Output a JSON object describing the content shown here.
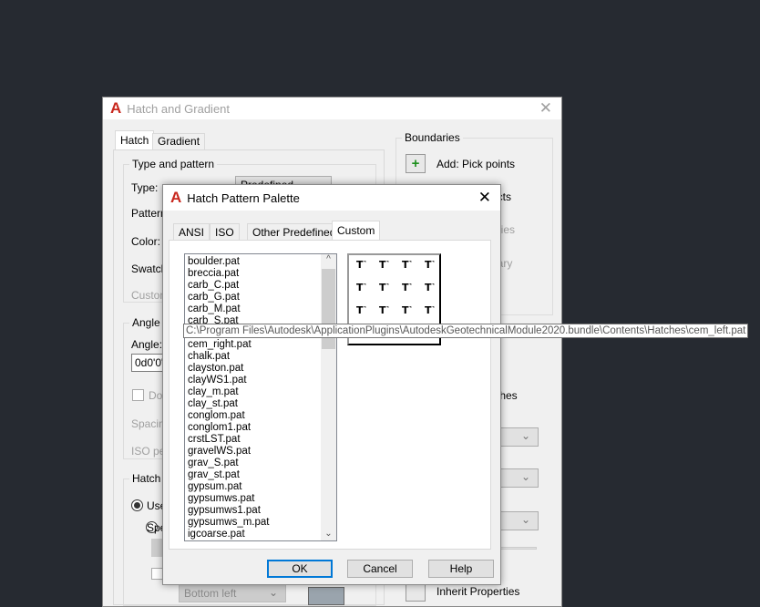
{
  "main": {
    "title": "Hatch and Gradient",
    "tabs": [
      "Hatch",
      "Gradient"
    ],
    "type_group": "Type and pattern",
    "type_label": "Type:",
    "type_value": "Predefined",
    "pattern_label": "Pattern",
    "color_label": "Color:",
    "swatch_label": "Swatch",
    "custom_label": "Custom",
    "angle_group": "Angle a",
    "angle_label": "Angle:",
    "angle_value": "0d0'0\"",
    "double_label": "Dou",
    "spacing_label": "Spacin",
    "iso_label": "ISO pe",
    "origin_group": "Hatch o",
    "use_current": "Use",
    "specified": "Spe",
    "origin_pos": "Bottom left",
    "boundaries_group": "Boundaries",
    "pick_points": "Add: Pick points",
    "select_objects": "ects",
    "remove": "aries",
    "recreate": "dary",
    "view": "s",
    "separate": "tches",
    "draw_order": "y",
    "inherit": "Inherit Properties"
  },
  "palette": {
    "title": "Hatch Pattern Palette",
    "tabs": [
      "ANSI",
      "ISO",
      "Other Predefined",
      "Custom"
    ],
    "active_tab": "Custom",
    "items": [
      "boulder.pat",
      "breccia.pat",
      "carb_C.pat",
      "carb_G.pat",
      "carb_M.pat",
      "carb_S.pat",
      "cem_left.pat",
      "cem_right.pat",
      "chalk.pat",
      "clayston.pat",
      "clayWS1.pat",
      "clay_m.pat",
      "clay_st.pat",
      "conglom.pat",
      "conglom1.pat",
      "crstLST.pat",
      "gravelWS.pat",
      "grav_S.pat",
      "grav_st.pat",
      "gypsum.pat",
      "gypsumws.pat",
      "gypsumws1.pat",
      "gypsumws_m.pat",
      "igcoarse.pat"
    ],
    "tooltip": "C:\\Program Files\\Autodesk\\ApplicationPlugins\\AutodeskGeotechnicalModule2020.bundle\\Contents\\Hatches\\cem_left.pat",
    "ok": "OK",
    "cancel": "Cancel",
    "help": "Help"
  },
  "colors": {
    "background": "#262a31",
    "accent": "#0078d7",
    "logo": "#c8281e"
  }
}
